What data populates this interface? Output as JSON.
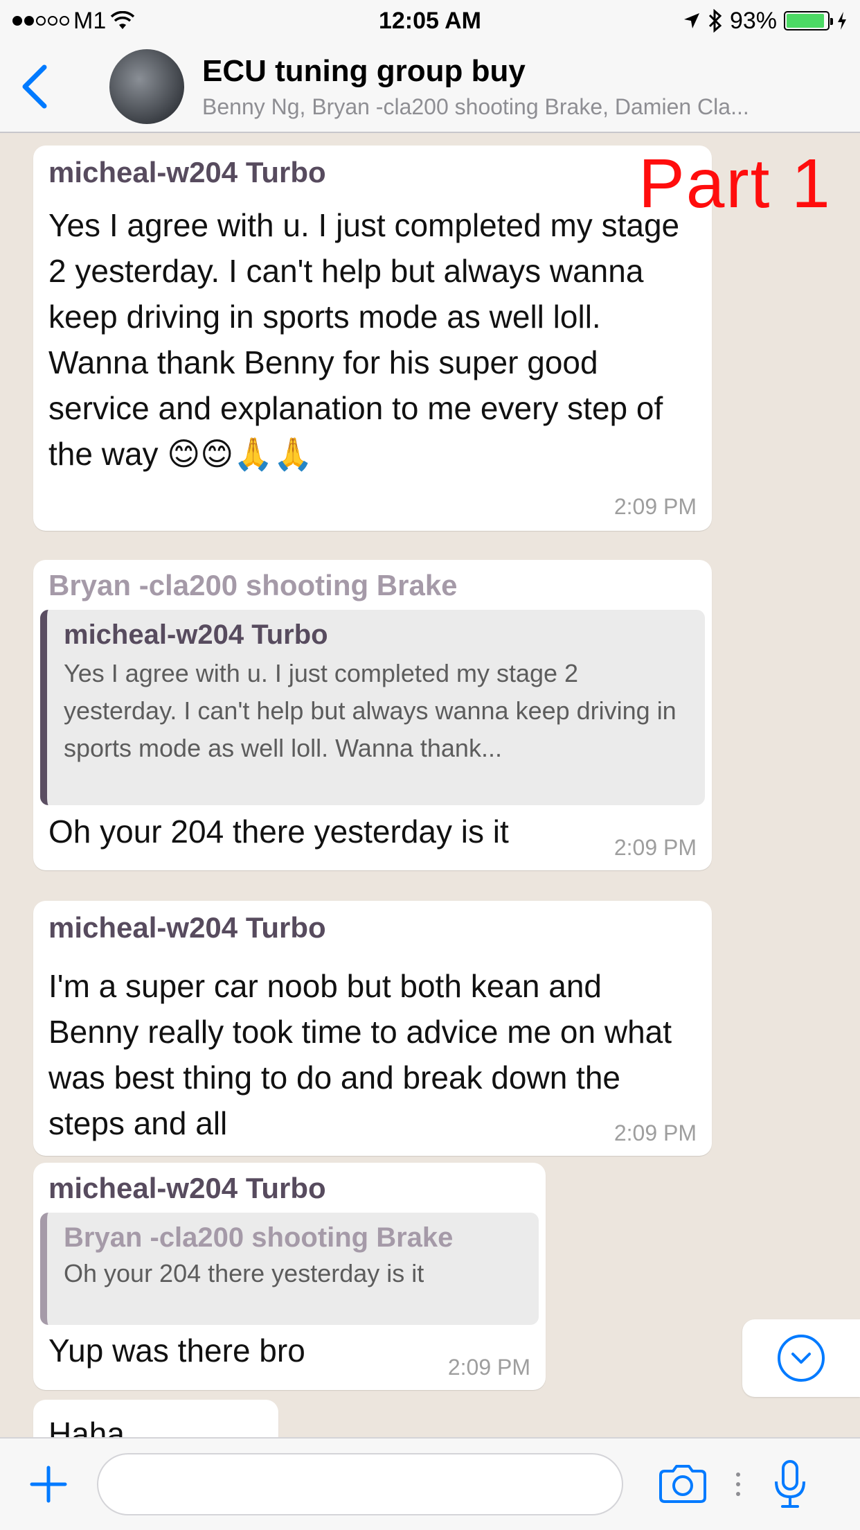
{
  "status_bar": {
    "carrier": "M1",
    "time": "12:05 AM",
    "battery": "93%",
    "battery_level": 0.93
  },
  "header": {
    "title": "ECU tuning group buy",
    "members": "Benny Ng, Bryan -cla200 shooting Brake, Damien Cla..."
  },
  "overlay_label": "Part 1",
  "messages": [
    {
      "sender": "micheal-w204 Turbo",
      "text": "Yes I agree with u. I just completed my stage 2 yesterday. I can't help but always wanna keep driving in sports mode as well loll. Wanna thank Benny for his super good service and explanation to me every step of the way 😊😊🙏🙏",
      "time": "2:09 PM"
    },
    {
      "sender": "Bryan -cla200 shooting Brake",
      "quote_sender": "micheal-w204 Turbo",
      "quote_text": "Yes I agree with u. I just completed my stage 2 yesterday. I can't help but always wanna keep driving in sports mode as well loll. Wanna thank...",
      "text": "Oh your 204 there yesterday is it",
      "time": "2:09 PM"
    },
    {
      "sender": "micheal-w204 Turbo",
      "text": "I'm a super car noob but both kean and Benny really took time to advice me on what was best thing to do and break down the steps and all",
      "time": "2:09 PM"
    },
    {
      "sender": "micheal-w204 Turbo",
      "quote_sender": "Bryan -cla200 shooting Brake",
      "quote_text": "Oh your 204 there yesterday is it",
      "text": "Yup was there bro",
      "time": "2:09 PM"
    },
    {
      "text": "Haha"
    }
  ],
  "input": {
    "placeholder": ""
  },
  "colors": {
    "accent": "#007aff",
    "sender": "#574b5e",
    "overlay": "#ff0d0d",
    "background": "#ece5dd"
  }
}
